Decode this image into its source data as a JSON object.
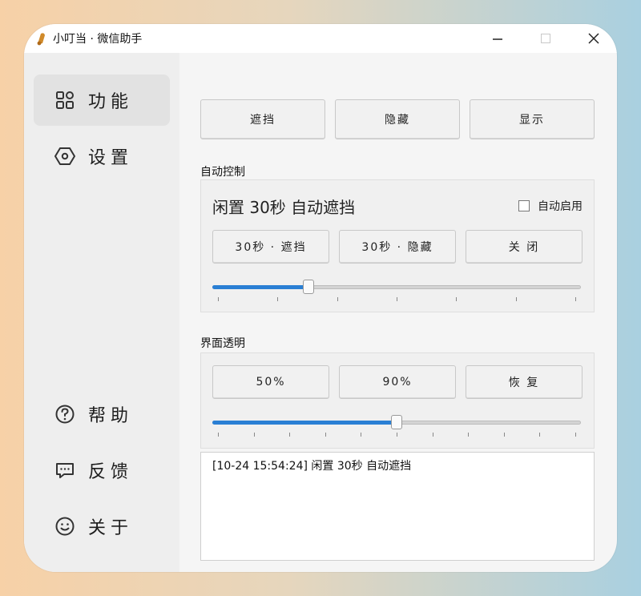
{
  "window": {
    "title": "小叮当 · 微信助手"
  },
  "sidebar": {
    "items": [
      {
        "label": "功能",
        "icon": "grid-icon",
        "active": true
      },
      {
        "label": "设置",
        "icon": "hexagon-settings-icon"
      },
      {
        "label": "帮助",
        "icon": "question-circle-icon"
      },
      {
        "label": "反馈",
        "icon": "message-icon"
      },
      {
        "label": "关于",
        "icon": "smile-icon"
      }
    ]
  },
  "top_buttons": [
    "遮挡",
    "隐藏",
    "显示"
  ],
  "auto_control": {
    "section_label": "自动控制",
    "status": "闲置 30秒 自动遮挡",
    "checkbox_label": "自动启用",
    "checkbox_checked": false,
    "buttons": [
      "30秒 · 遮挡",
      "30秒 · 隐藏",
      "关 闭"
    ],
    "slider_value": 0.26
  },
  "transparency": {
    "section_label": "界面透明",
    "buttons": [
      "50%",
      "90%",
      "恢 复"
    ],
    "slider_value": 0.5
  },
  "log": {
    "entries": [
      "[10-24 15:54:24]  闲置 30秒 自动遮挡"
    ]
  },
  "colors": {
    "accent": "#2a7fd4",
    "sidebar_bg": "#eeeeee",
    "content_bg": "#f5f5f5"
  }
}
